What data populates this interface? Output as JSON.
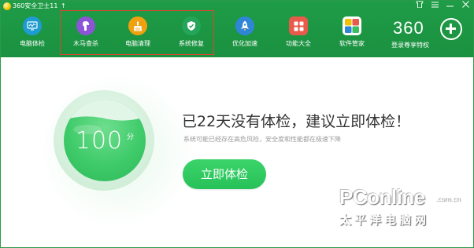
{
  "window": {
    "title": "360安全卫士11",
    "controls": [
      "shirt-icon",
      "menu-icon",
      "minimize-icon",
      "close-icon"
    ]
  },
  "nav": {
    "items": [
      {
        "label": "电脑体检",
        "icon": "monitor-check-icon",
        "color": "#1e9bd1"
      },
      {
        "label": "木马查杀",
        "icon": "horse-icon",
        "color": "#8b55d6"
      },
      {
        "label": "电脑清理",
        "icon": "broom-icon",
        "color": "#f0a10f"
      },
      {
        "label": "系统修复",
        "icon": "shield-icon",
        "color": "#24a55a"
      },
      {
        "label": "优化加速",
        "icon": "rocket-icon",
        "color": "#2f86d6"
      },
      {
        "label": "功能大全",
        "icon": "grid-icon",
        "color": "#e85b4a"
      },
      {
        "label": "软件管家",
        "icon": "apps-icon",
        "color": "#f2c200"
      }
    ],
    "highlight_color": "#e0442f"
  },
  "vip": {
    "number": "360",
    "label": "登录尊享特权",
    "icon": "plus-icon"
  },
  "status": {
    "score": "100",
    "score_unit": "分",
    "headline": "已22天没有体检，建议立即体检！",
    "subtext": "系统可能已经存在高危风险，安全度和性能都在极速下降",
    "button": "立即体检"
  },
  "watermark": {
    "text": "PConline",
    "domain": ".com.cn",
    "sub": "太平洋电脑网"
  },
  "colors": {
    "header": "#1f9c47",
    "accent": "#2fbf5d"
  }
}
